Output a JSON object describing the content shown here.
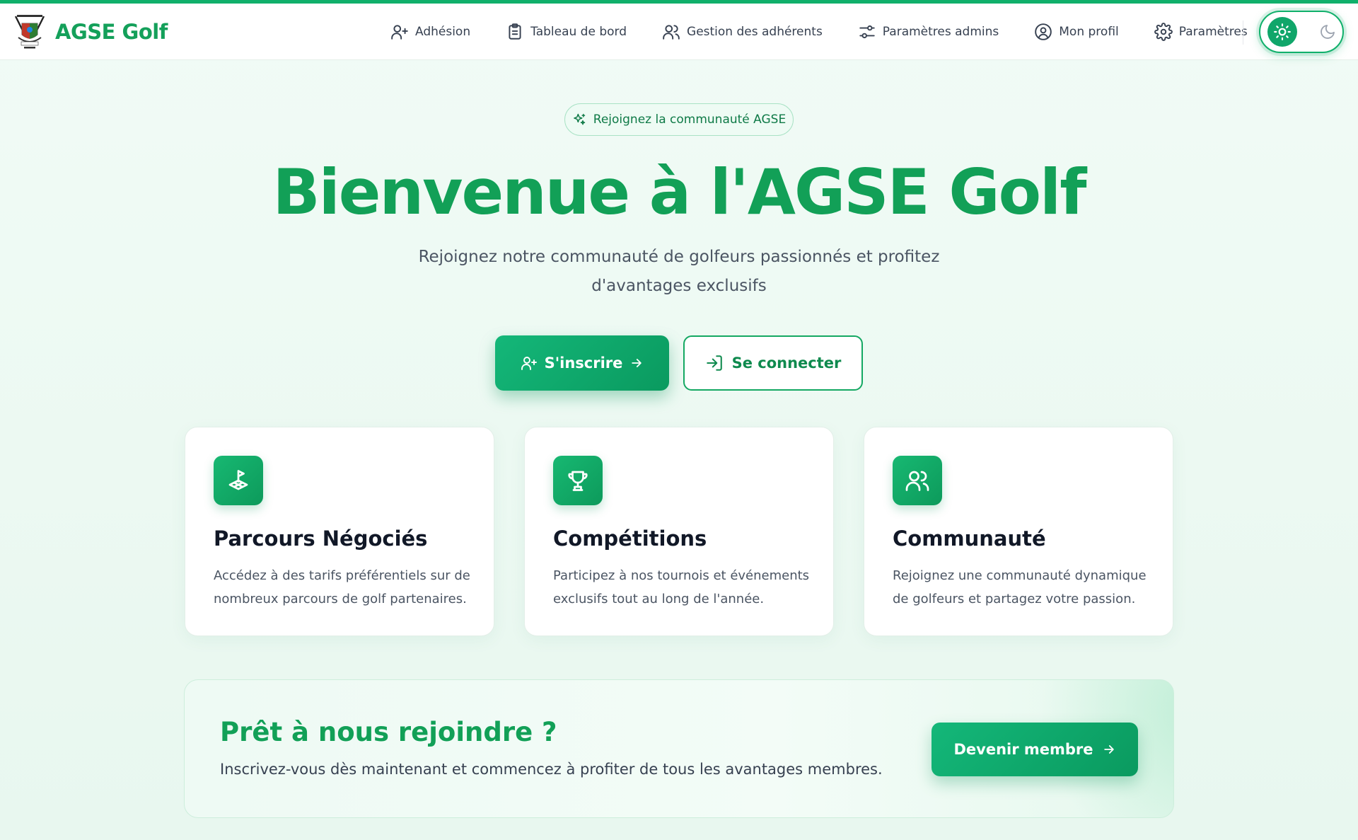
{
  "brand": {
    "name": "AGSE Golf",
    "logo_icon": "golf-club-crest-logo"
  },
  "nav": {
    "items": [
      {
        "label": "Adhésion",
        "icon": "user-plus-icon"
      },
      {
        "label": "Tableau de bord",
        "icon": "clipboard-icon"
      },
      {
        "label": "Gestion des adhérents",
        "icon": "users-icon"
      },
      {
        "label": "Paramètres admins",
        "icon": "sliders-icon"
      },
      {
        "label": "Mon profil",
        "icon": "user-circle-icon"
      },
      {
        "label": "Paramètres",
        "icon": "gear-icon"
      }
    ]
  },
  "theme": {
    "active": "light"
  },
  "hero": {
    "badge": "Rejoignez la communauté AGSE",
    "title": "Bienvenue à l'AGSE Golf",
    "subtitle_line1": "Rejoignez notre communauté de golfeurs passionnés et profitez",
    "subtitle_line2": "d'avantages exclusifs",
    "signup_label": "S'inscrire",
    "login_label": "Se connecter"
  },
  "features": [
    {
      "title": "Parcours Négociés",
      "line1": "Accédez à des tarifs préférentiels sur de",
      "line2": "nombreux parcours de golf partenaires.",
      "icon": "golf-flag-icon"
    },
    {
      "title": "Compétitions",
      "line1": "Participez à nos tournois et événements",
      "line2": "exclusifs tout au long de l'année.",
      "icon": "trophy-icon"
    },
    {
      "title": "Communauté",
      "line1": "Rejoignez une communauté dynamique",
      "line2": "de golfeurs et partagez votre passion.",
      "icon": "users-icon"
    }
  ],
  "cta": {
    "title": "Prêt à nous rejoindre ?",
    "subtitle": "Inscrivez-vous dès maintenant et commencez à profiter de tous les avantages membres.",
    "button_label": "Devenir membre"
  },
  "colors": {
    "accent": "#10b06b",
    "accent_dark": "#0a9a5f",
    "title_green": "#12a057"
  }
}
